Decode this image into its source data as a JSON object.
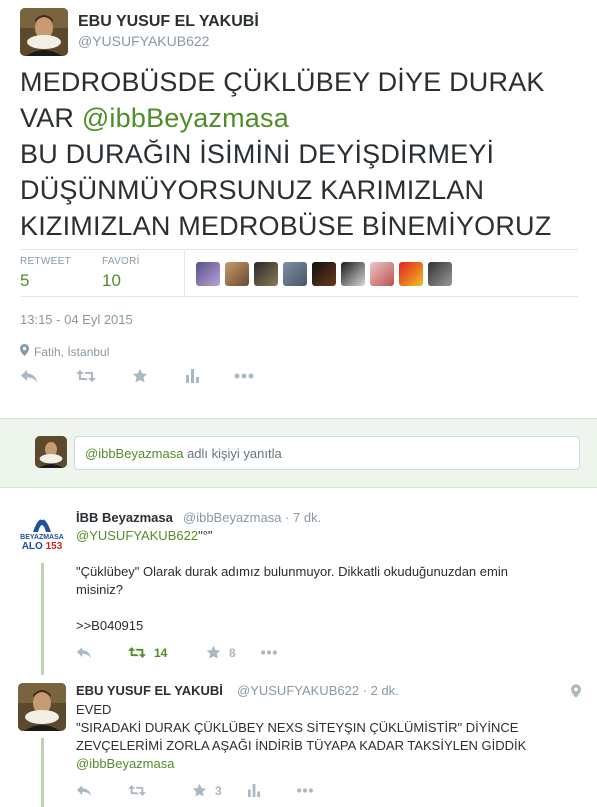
{
  "main_tweet": {
    "author_name": "EBU YUSUF EL YAKUBİ",
    "author_handle": "@YUSUFYAKUB622",
    "text_line1": "MEDROBÜSDE ÇÜKLÜBEY DİYE DURAK",
    "text_line2_prefix": "VAR ",
    "text_mention": "@ibbBeyazmasa",
    "text_line3": "BU DURAĞIN İSİMİNİ DEYİŞDİRMEYİ",
    "text_line4": "DÜŞÜNMÜYORSUNUZ KARIMIZLAN",
    "text_line5": "KIZIMIZLAN MEDROBÜSE BİNEMİYORUZ",
    "retweet_label": "RETWEET",
    "retweet_count": "5",
    "favorite_label": "FAVORİ",
    "favorite_count": "10",
    "timestamp": "13:15 - 04 Eyl 2015",
    "location": "Fatih, İstanbul"
  },
  "reply_box": {
    "mention": "@ibbBeyazmasa",
    "suffix": " adlı kişiyi yanıtla"
  },
  "reply1": {
    "logo_top": "BEYAZMASA",
    "logo_alo": "ALO",
    "logo_num": "153",
    "author_name": "İBB Beyazmasa",
    "meta": "@ibbBeyazmasa · 7 dk.",
    "mention_line": "@YUSUFYAKUB622",
    "mention_suffix": "\"°\"",
    "text_line1": "\"Çüklübey\" Olarak durak adımız bulunmuyor. Dikkatli okuduğunuzdan emin",
    "text_line2": "misiniz?",
    "text_line3": ">>B040915",
    "retweet_count": "14",
    "favorite_count": "8"
  },
  "reply2": {
    "author_name": "EBU YUSUF EL YAKUBİ",
    "meta": "@YUSUFYAKUB622 · 2 dk.",
    "text_line1": "EVED",
    "text_line2": "\"SIRADAKİ DURAK ÇÜKLÜBEY NEXS SİTEYŞIN ÇÜKLÜMİSTİR\" DİYİNCE",
    "text_line3": "ZEVÇELERİMİ ZORLA AŞAĞI İNDİRİB TÜYAPA KADAR TAKSİYLEN GİDDİK",
    "text_mention": "@ibbBeyazmasa",
    "favorite_count": "3"
  },
  "icons": {
    "reply": "reply-icon",
    "retweet": "retweet-icon",
    "favorite": "star-icon",
    "stats": "bar-chart-icon",
    "more": "more-icon",
    "location": "location-pin-icon"
  },
  "colors": {
    "accent_green": "#4f8e27",
    "muted": "#8899a6",
    "reply_bar_bg": "#edf5ec",
    "thread_line": "#b9d3b0"
  }
}
